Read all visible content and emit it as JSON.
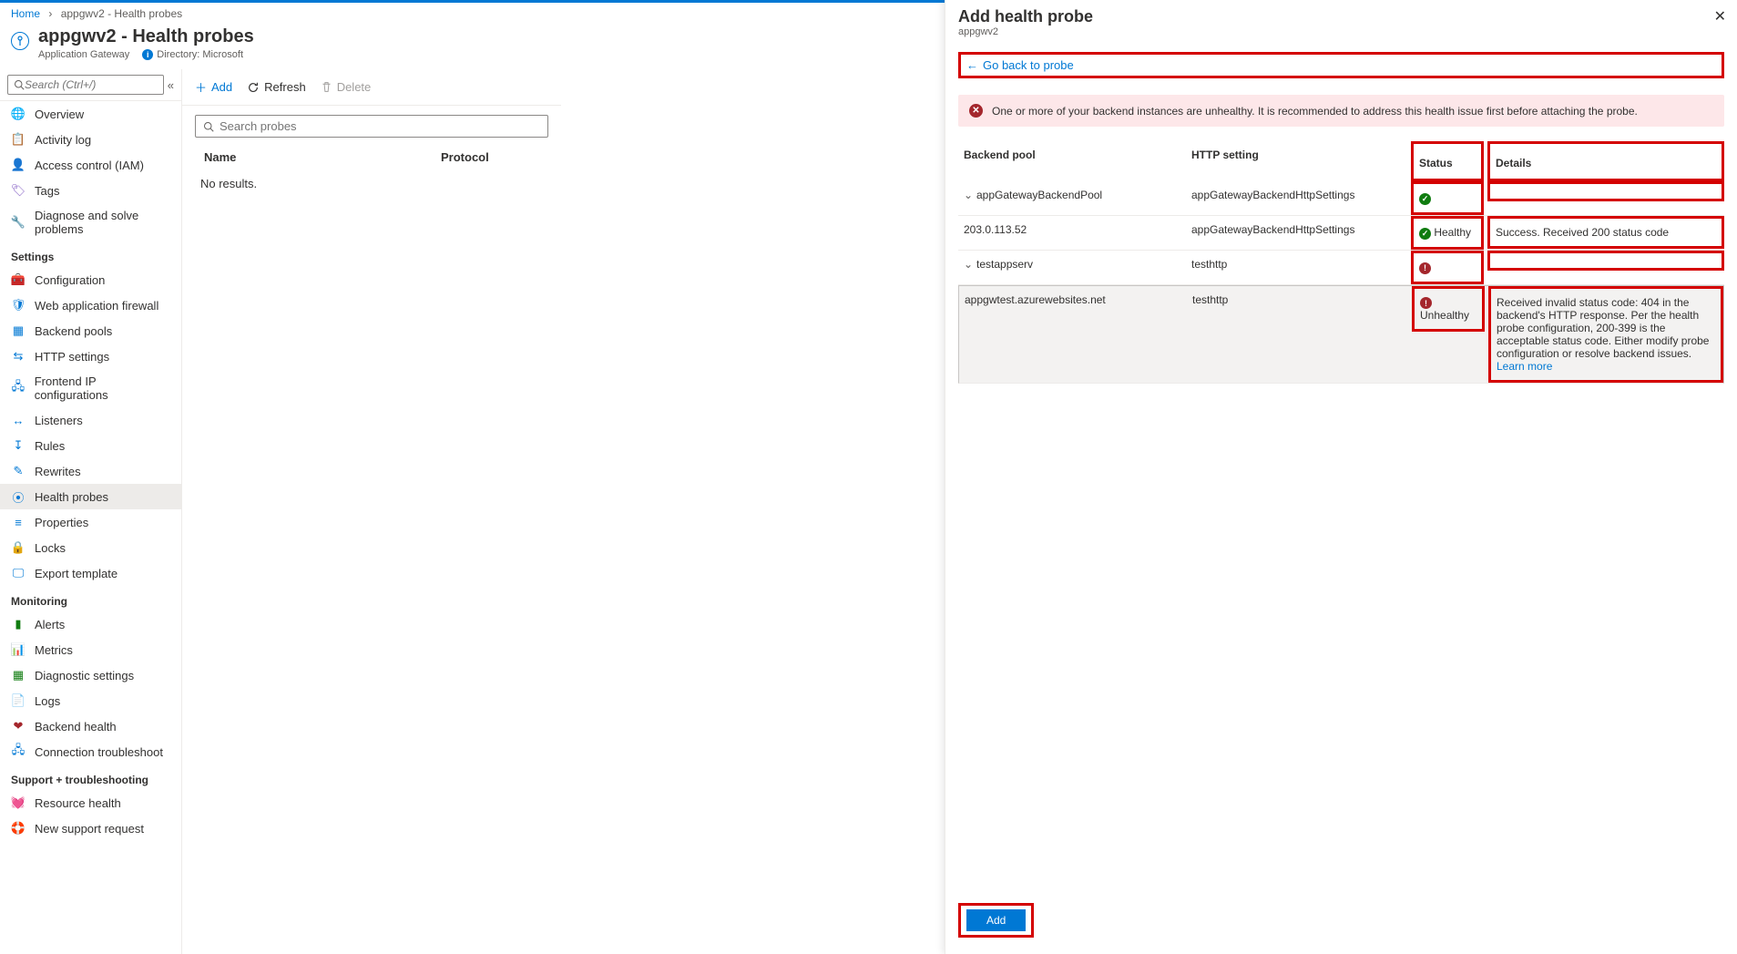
{
  "breadcrumb": {
    "home": "Home",
    "current": "appgwv2 - Health probes"
  },
  "header": {
    "title": "appgwv2 - Health probes",
    "subtitle": "Application Gateway",
    "directory_label": "Directory: Microsoft"
  },
  "search": {
    "placeholder": "Search (Ctrl+/)"
  },
  "nav": {
    "items_top": [
      {
        "label": "Overview",
        "icon": "🌐",
        "color": "#107c10"
      },
      {
        "label": "Activity log",
        "icon": "📋",
        "color": "#0078d4"
      },
      {
        "label": "Access control (IAM)",
        "icon": "👤",
        "color": "#0078d4"
      },
      {
        "label": "Tags",
        "icon": "🏷",
        "color": "#8661c5"
      },
      {
        "label": "Diagnose and solve problems",
        "icon": "🔧",
        "color": "#605e5c"
      }
    ],
    "settings_label": "Settings",
    "items_settings": [
      {
        "label": "Configuration",
        "icon": "🧰",
        "color": "#a4262c"
      },
      {
        "label": "Web application firewall",
        "icon": "🛡",
        "color": "#0078d4"
      },
      {
        "label": "Backend pools",
        "icon": "▦",
        "color": "#0078d4"
      },
      {
        "label": "HTTP settings",
        "icon": "⇆",
        "color": "#0078d4"
      },
      {
        "label": "Frontend IP configurations",
        "icon": "🖧",
        "color": "#0078d4"
      },
      {
        "label": "Listeners",
        "icon": "↔",
        "color": "#0078d4"
      },
      {
        "label": "Rules",
        "icon": "↧",
        "color": "#0078d4"
      },
      {
        "label": "Rewrites",
        "icon": "✎",
        "color": "#0078d4"
      },
      {
        "label": "Health probes",
        "icon": "⦿",
        "color": "#0078d4",
        "active": true
      },
      {
        "label": "Properties",
        "icon": "≡",
        "color": "#0078d4"
      },
      {
        "label": "Locks",
        "icon": "🔒",
        "color": "#605e5c"
      },
      {
        "label": "Export template",
        "icon": "🖵",
        "color": "#0078d4"
      }
    ],
    "monitoring_label": "Monitoring",
    "items_monitoring": [
      {
        "label": "Alerts",
        "icon": "▮",
        "color": "#107c10"
      },
      {
        "label": "Metrics",
        "icon": "📊",
        "color": "#0078d4"
      },
      {
        "label": "Diagnostic settings",
        "icon": "▦",
        "color": "#107c10"
      },
      {
        "label": "Logs",
        "icon": "📄",
        "color": "#ca5010"
      },
      {
        "label": "Backend health",
        "icon": "❤",
        "color": "#a4262c"
      },
      {
        "label": "Connection troubleshoot",
        "icon": "🖧",
        "color": "#0078d4"
      }
    ],
    "support_label": "Support + troubleshooting",
    "items_support": [
      {
        "label": "Resource health",
        "icon": "💓",
        "color": "#605e5c"
      },
      {
        "label": "New support request",
        "icon": "🛟",
        "color": "#605e5c"
      }
    ]
  },
  "toolbar": {
    "add": "Add",
    "refresh": "Refresh",
    "delete": "Delete"
  },
  "probe_search": {
    "placeholder": "Search probes"
  },
  "probe_table": {
    "col_name": "Name",
    "col_protocol": "Protocol",
    "empty": "No results."
  },
  "blade": {
    "title": "Add health probe",
    "subtitle": "appgwv2",
    "go_back": "Go back to probe",
    "alert": "One or more of your backend instances are unhealthy. It is recommended to address this health issue first before attaching the probe.",
    "columns": {
      "pool": "Backend pool",
      "http": "HTTP setting",
      "status": "Status",
      "details": "Details"
    },
    "rows": [
      {
        "type": "group",
        "pool": "appGatewayBackendPool",
        "http": "appGatewayBackendHttpSettings",
        "status": "ok"
      },
      {
        "type": "child",
        "pool": "203.0.113.52",
        "http": "appGatewayBackendHttpSettings",
        "status": "ok",
        "status_text": "Healthy",
        "details": "Success. Received 200 status code"
      },
      {
        "type": "group",
        "pool": "testappserv",
        "http": "testhttp",
        "status": "bad"
      },
      {
        "type": "child-hl",
        "pool": "appgwtest.azurewebsites.net",
        "http": "testhttp",
        "status": "bad",
        "status_text": "Unhealthy",
        "details": "Received invalid status code: 404 in the backend's HTTP response. Per the health probe configuration, 200-399 is the acceptable status code. Either modify probe configuration or resolve backend issues.",
        "learn": "Learn more"
      }
    ],
    "add_btn": "Add"
  }
}
